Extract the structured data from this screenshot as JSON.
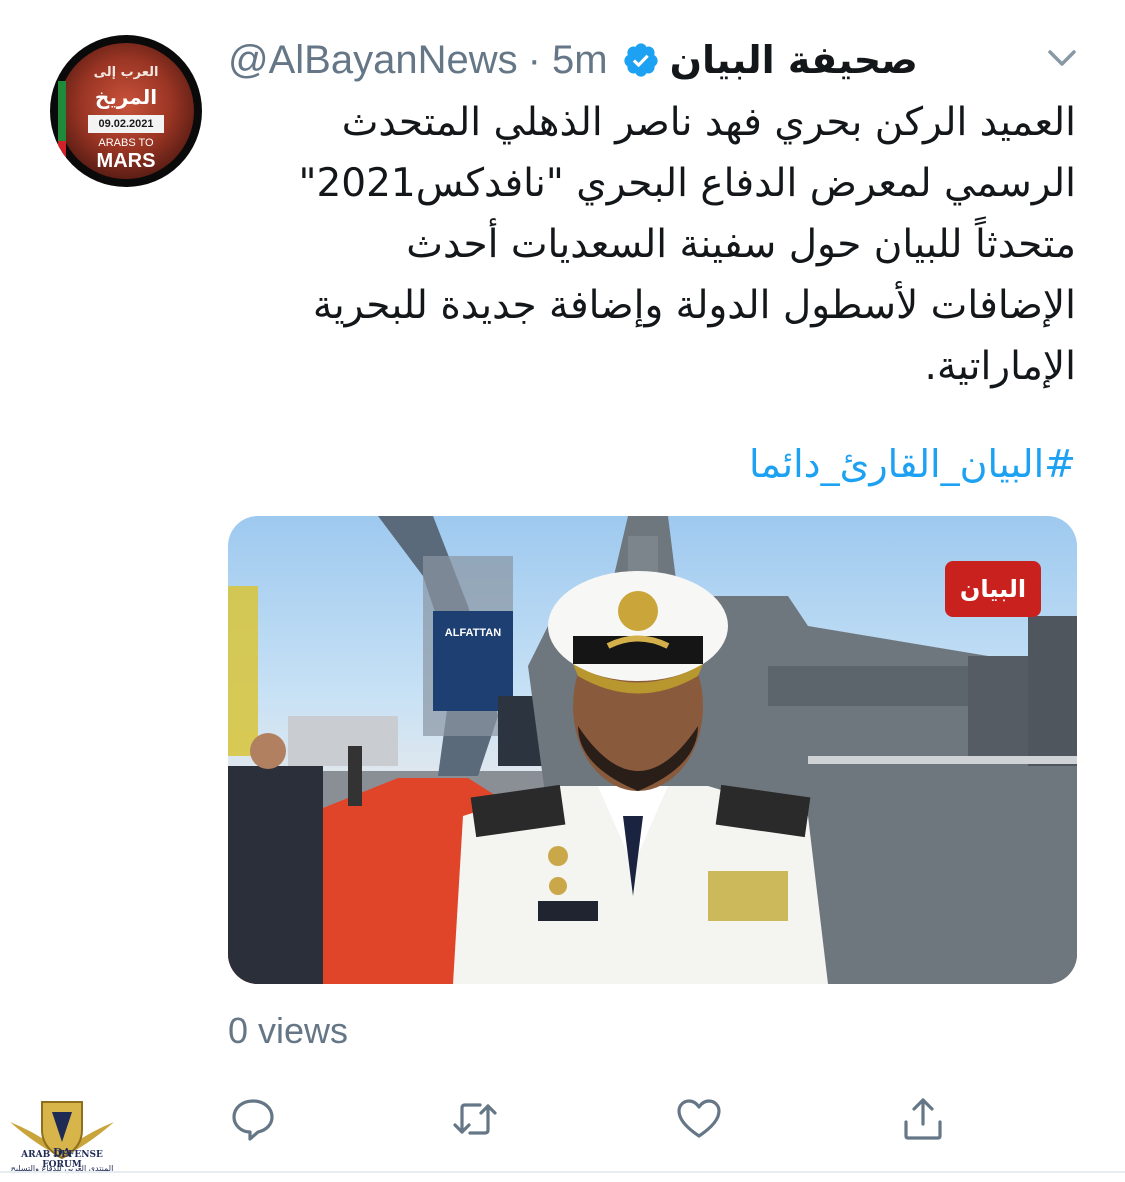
{
  "avatar": {
    "line1": "العرب إلى",
    "line2": "المريخ",
    "date": "09.02.2021",
    "line3": "ARABS TO",
    "line4": "MARS"
  },
  "tweet": {
    "display_name": "صحيفة البيان",
    "handle": "@AlBayanNews",
    "time": "· 5m",
    "verified": true,
    "text_lines": [
      "العميد الركن بحري فهد ناصر الذهلي المتحدث",
      "الرسمي لمعرض الدفاع البحري \"نافدكس2021\"",
      "متحدثاً للبيان حول سفينة السعديات أحدث",
      "الإضافات لأسطول الدولة وإضافة جديدة للبحرية",
      "الإماراتية."
    ],
    "hashtag": "#البيان_القارئ_دائما",
    "views": "0 views"
  },
  "media": {
    "channel_badge": "البيان",
    "billboard": "ALFATTAN"
  },
  "icons": {
    "reply": "reply-icon",
    "retweet": "retweet-icon",
    "like": "like-icon",
    "share": "share-icon",
    "menu": "chevron-down-icon",
    "verified": "verified-badge-icon"
  },
  "watermark": {
    "title": "ARAB DEFENSE FORUM",
    "subtitle": "المنتدى العربي للدفاع والتسليح",
    "logo_letters": "DA"
  },
  "colors": {
    "link": "#1da1f2",
    "muted": "#657786",
    "text": "#14171a",
    "badge_red": "#c9221e"
  }
}
